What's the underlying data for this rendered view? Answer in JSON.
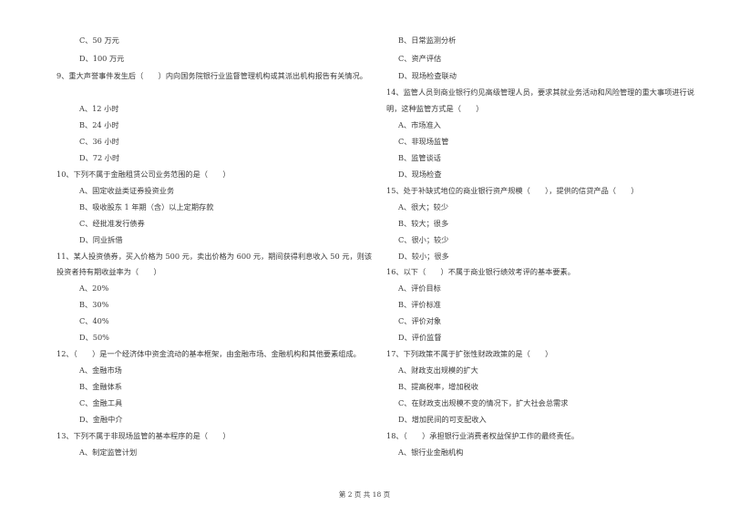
{
  "left_column": [
    {
      "type": "option",
      "text": "C、50 万元"
    },
    {
      "type": "option",
      "text": "D、100 万元"
    },
    {
      "type": "question",
      "text": "9、重大声誉事件发生后（　　）内向国务院银行业监督管理机构或其派出机构报告有关情况。"
    },
    {
      "type": "option",
      "text": "A、12 小时"
    },
    {
      "type": "option",
      "text": "B、24 小时"
    },
    {
      "type": "option",
      "text": "C、36 小时"
    },
    {
      "type": "option",
      "text": "D、72 小时"
    },
    {
      "type": "question",
      "text": "10、下列不属于金融租赁公司业务范围的是（　　）"
    },
    {
      "type": "option",
      "text": "A、固定收益类证券投资业务"
    },
    {
      "type": "option",
      "text": "B、吸收股东 1 年期（含）以上定期存款"
    },
    {
      "type": "option",
      "text": "C、经批准发行债券"
    },
    {
      "type": "option",
      "text": "D、同业拆借"
    },
    {
      "type": "question",
      "text": "11、某人投资债券，买入价格为 500 元，卖出价格为 600 元，期间获得利息收入 50 元，则该"
    },
    {
      "type": "question-cont",
      "text": "投资者持有期收益率为（　　）"
    },
    {
      "type": "option",
      "text": "A、20%"
    },
    {
      "type": "option",
      "text": "B、30%"
    },
    {
      "type": "option",
      "text": "C、40%"
    },
    {
      "type": "option",
      "text": "D、50%"
    },
    {
      "type": "question",
      "text": "12、（　　）是一个经济体中资金流动的基本框架，由金融市场、金融机构和其他要素组成。"
    },
    {
      "type": "option",
      "text": "A、金融市场"
    },
    {
      "type": "option",
      "text": "B、金融体系"
    },
    {
      "type": "option",
      "text": "C、金融工具"
    },
    {
      "type": "option",
      "text": "D、金融中介"
    },
    {
      "type": "question",
      "text": "13、下列不属于非现场监管的基本程序的是（　　）"
    },
    {
      "type": "option",
      "text": "A、制定监管计划"
    }
  ],
  "right_column": [
    {
      "type": "option",
      "text": "B、日常监测分析"
    },
    {
      "type": "option",
      "text": "C、资产评估"
    },
    {
      "type": "option",
      "text": "D、现场检查联动"
    },
    {
      "type": "question",
      "text": "14、监管人员到商业银行约见高级管理人员，要求其就业务活动和风险管理的重大事项进行说"
    },
    {
      "type": "question-cont",
      "text": "明，这种监管方式是（　　）"
    },
    {
      "type": "option",
      "text": "A、市场准入"
    },
    {
      "type": "option",
      "text": "C、非现场监管"
    },
    {
      "type": "option",
      "text": "B、监管谈话"
    },
    {
      "type": "option",
      "text": "D、现场检查"
    },
    {
      "type": "question",
      "text": "15、处于补缺式地位的商业银行资产规模（　　），提供的信贷产品（　　）"
    },
    {
      "type": "option",
      "text": "A、很大；较少"
    },
    {
      "type": "option",
      "text": "B、较大；很多"
    },
    {
      "type": "option",
      "text": "C、很小；较少"
    },
    {
      "type": "option",
      "text": "D、较小；很多"
    },
    {
      "type": "question",
      "text": "16、以下（　　）不属于商业银行绩效考评的基本要素。"
    },
    {
      "type": "option",
      "text": "A、评价目标"
    },
    {
      "type": "option",
      "text": "B、评价标准"
    },
    {
      "type": "option",
      "text": "C、评价对象"
    },
    {
      "type": "option",
      "text": "D、评价监督"
    },
    {
      "type": "question",
      "text": "17、下列政策不属于扩张性财政政策的是（　　）"
    },
    {
      "type": "option",
      "text": "A、财政支出规模的扩大"
    },
    {
      "type": "option",
      "text": "B、提高税率，增加税收"
    },
    {
      "type": "option",
      "text": "C、在财政支出规模不变的情况下，扩大社会总需求"
    },
    {
      "type": "option",
      "text": "D、增加民间的可支配收入"
    },
    {
      "type": "question",
      "text": "18、（　　）承担银行业消费者权益保护工作的最终责任。"
    },
    {
      "type": "option",
      "text": "A、银行业金融机构"
    }
  ],
  "footer": {
    "page_text": "第 2 页 共 18 页"
  }
}
